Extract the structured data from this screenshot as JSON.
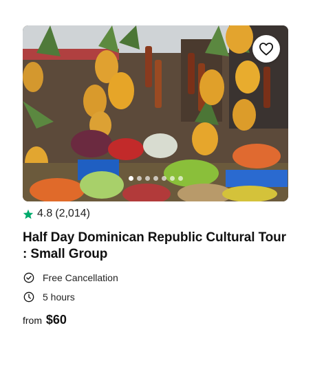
{
  "card": {
    "image_alt": "Fruit market stall with hanging pineapples and piles of vegetables",
    "favorite_icon": "heart-outline-icon",
    "carousel": {
      "total": 7,
      "active": 0
    },
    "rating": {
      "score": "4.8",
      "count": "(2,014)",
      "star_color": "#00aa6c",
      "star_icon": "star-icon"
    },
    "title": "Half Day Dominican Republic Cultural Tour : Small Group",
    "features": [
      {
        "icon": "check-circle-icon",
        "label": "Free Cancellation"
      },
      {
        "icon": "clock-icon",
        "label": "5 hours"
      }
    ],
    "price": {
      "prefix": "from",
      "amount": "$60"
    }
  }
}
